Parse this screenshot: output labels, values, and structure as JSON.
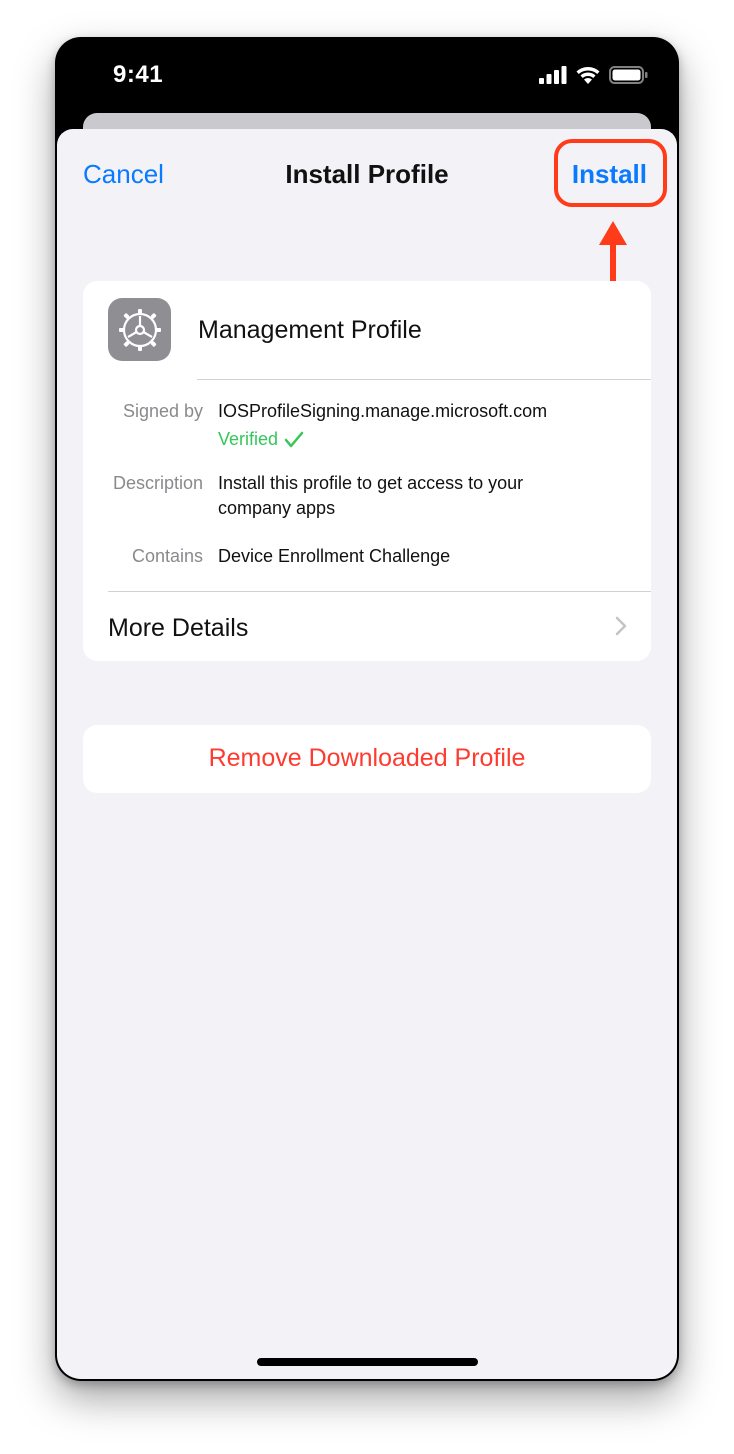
{
  "status_bar": {
    "time": "9:41"
  },
  "nav": {
    "cancel_label": "Cancel",
    "title": "Install Profile",
    "install_label": "Install"
  },
  "profile": {
    "icon": "gear-icon",
    "name": "Management Profile",
    "signed_by_label": "Signed by",
    "signed_by_value": "IOSProfileSigning.manage.microsoft.com",
    "verified_label": "Verified",
    "description_label": "Description",
    "description_line1": "Install this profile to get access to your",
    "description_line2": "company apps",
    "contains_label": "Contains",
    "contains_value": "Device Enrollment Challenge",
    "more_details_label": "More Details"
  },
  "actions": {
    "remove_label": "Remove Downloaded Profile"
  },
  "colors": {
    "accent": "#0a7aff",
    "destructive": "#ff3b30",
    "verified": "#34c759",
    "annotation": "#ff3b1a",
    "background": "#f2f2f7"
  }
}
